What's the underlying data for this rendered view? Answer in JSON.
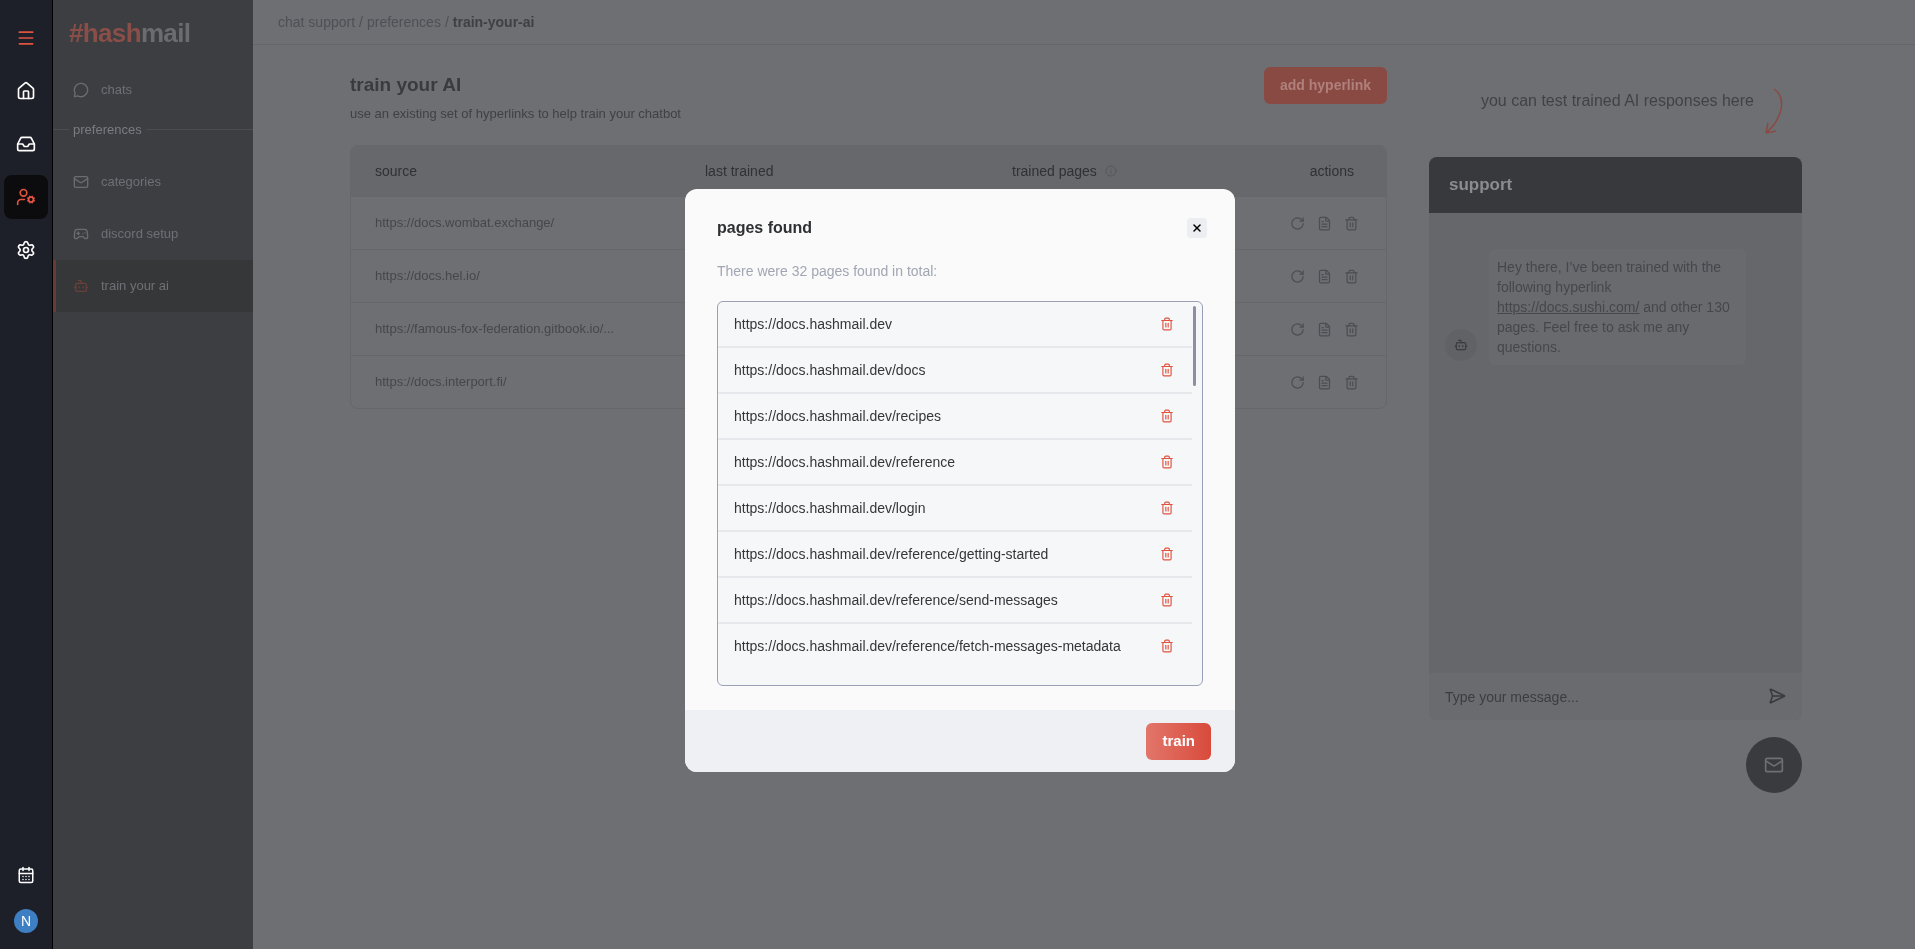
{
  "rail": {
    "items": [
      {
        "selected": false
      },
      {
        "selected": false
      },
      {
        "selected": false
      },
      {
        "selected": true
      },
      {
        "selected": false
      }
    ],
    "calendar": {
      "selected": false
    },
    "avatar": {
      "initial": "N"
    }
  },
  "sidebar": {
    "logo": [
      "#hash",
      "mail"
    ],
    "items": [
      {
        "kind": "item",
        "label": "chats",
        "selected": false
      },
      {
        "kind": "section",
        "label": "preferences"
      },
      {
        "kind": "item",
        "label": "categories",
        "selected": false
      },
      {
        "kind": "item",
        "label": "discord setup",
        "selected": false
      },
      {
        "kind": "item",
        "label": "train your ai",
        "selected": true
      }
    ]
  },
  "breadcrumb": {
    "separator": "/",
    "items": [
      "chat support",
      "preferences",
      "train-your-ai"
    ]
  },
  "page": {
    "title": "train your AI",
    "subtitle": "use an existing set of hyperlinks to help train your chatbot",
    "add_button": "add hyperlink"
  },
  "table": {
    "columns": [
      "source",
      "last trained",
      "trained pages",
      "actions"
    ],
    "rows": [
      {
        "source": "https://docs.wombat.exchange/"
      },
      {
        "source": "https://docs.hel.io/"
      },
      {
        "source": "https://famous-fox-federation.gitbook.io/..."
      },
      {
        "source": "https://docs.interport.fi/"
      }
    ]
  },
  "chat": {
    "hint": "you can test trained AI responses here",
    "header": "support",
    "message": {
      "before": "Hey there, I’ve been trained with the following hyperlink",
      "link": "https://docs.sushi.com/",
      "after": "and other 130 pages. Feel free to ask me any questions."
    },
    "input": {
      "placeholder": "Type your message..."
    }
  },
  "modal": {
    "title": "pages found",
    "summary": "There were 32 pages found in total:",
    "pages": [
      "https://docs.hashmail.dev",
      "https://docs.hashmail.dev/docs",
      "https://docs.hashmail.dev/recipes",
      "https://docs.hashmail.dev/reference",
      "https://docs.hashmail.dev/login",
      "https://docs.hashmail.dev/reference/getting-started",
      "https://docs.hashmail.dev/reference/send-messages",
      "https://docs.hashmail.dev/reference/fetch-messages-metadata"
    ],
    "train_button": "train"
  }
}
